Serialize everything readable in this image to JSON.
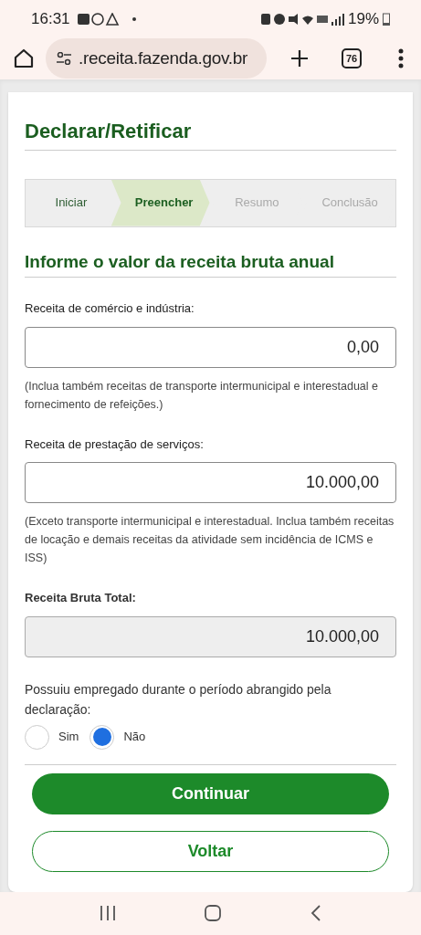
{
  "status_bar": {
    "time": "16:31",
    "battery": "19%"
  },
  "browser": {
    "url": ".receita.fazenda.gov.br",
    "tab_count": "76"
  },
  "page": {
    "title": "Declarar/Retificar",
    "steps": [
      {
        "label": "Iniciar",
        "selected": false,
        "disabled": false
      },
      {
        "label": "Preencher",
        "selected": true,
        "disabled": false
      },
      {
        "label": "Resumo",
        "selected": false,
        "disabled": true
      },
      {
        "label": "Conclusão",
        "selected": false,
        "disabled": true
      }
    ],
    "section_title": "Informe o valor da receita bruta anual",
    "fields": [
      {
        "label": "Receita de comércio e indústria:",
        "value": "0,00",
        "disabled": false,
        "hint": "(Inclua também receitas de transporte intermunicipal e interestadual e fornecimento de refeições.)"
      },
      {
        "label": "Receita de prestação de serviços:",
        "value": "10.000,00",
        "disabled": false,
        "hint": "(Exceto transporte intermunicipal e interestadual. Inclua também receitas de locação e demais receitas da atividade sem incidência de ICMS e ISS)"
      },
      {
        "label": "Receita Bruta Total:",
        "value": "10.000,00",
        "disabled": true
      }
    ],
    "question": "Possuiu empregado durante o período abrangido pela declaração:",
    "options": [
      {
        "label": "Sim",
        "selected": false
      },
      {
        "label": "Não",
        "selected": true
      }
    ],
    "buttons": [
      {
        "label": "Continuar",
        "kind": "primary"
      },
      {
        "label": "Voltar",
        "kind": "secondary"
      }
    ]
  }
}
